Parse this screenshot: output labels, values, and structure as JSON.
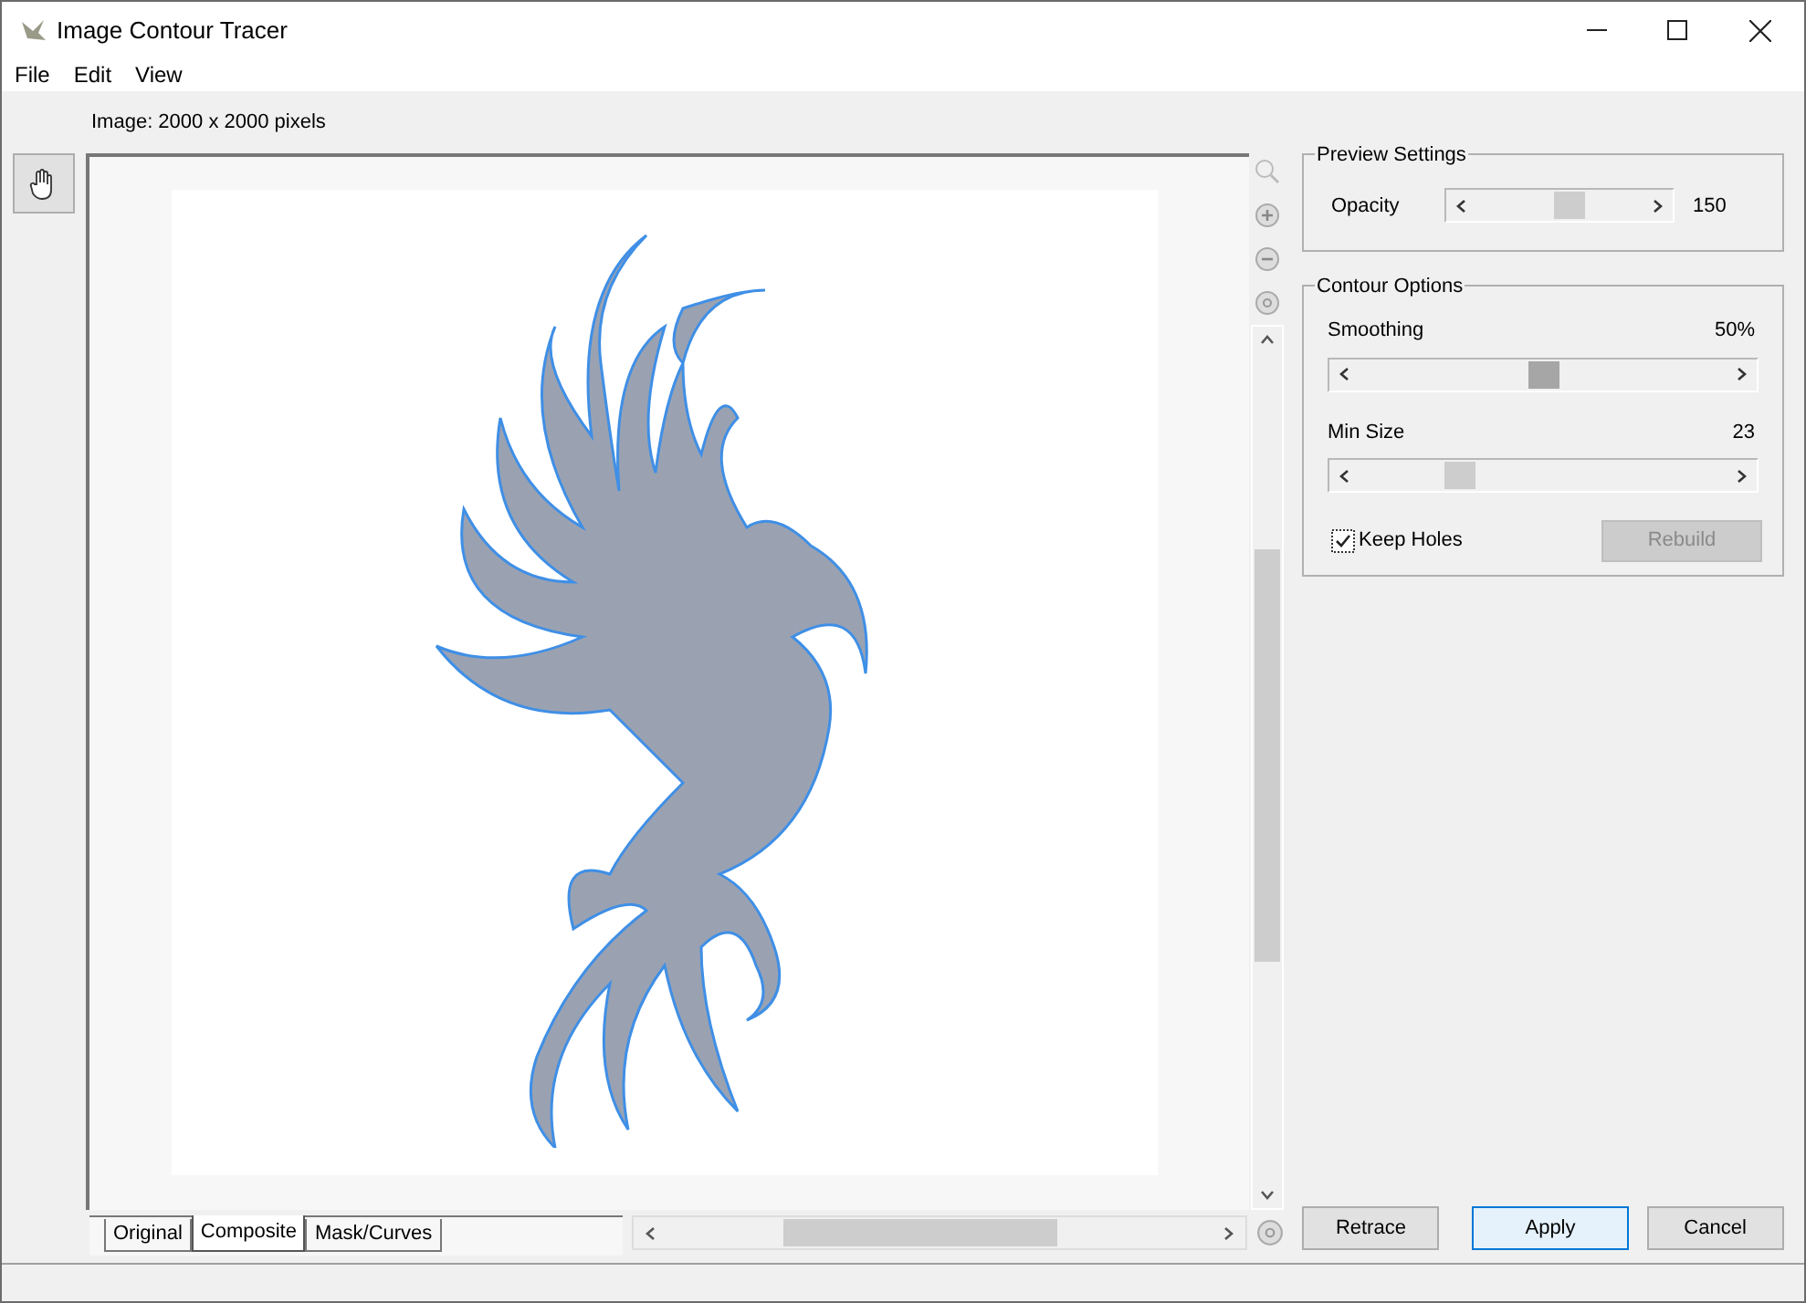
{
  "window": {
    "title": "Image Contour Tracer"
  },
  "menu": [
    "File",
    "Edit",
    "View"
  ],
  "image_info": "Image: 2000 x 2000 pixels",
  "view_tabs": [
    {
      "label": "Original",
      "selected": false
    },
    {
      "label": "Composite",
      "selected": true
    },
    {
      "label": "Mask/Curves",
      "selected": false
    }
  ],
  "preview_settings": {
    "title": "Preview Settings",
    "opacity": {
      "label": "Opacity",
      "level": 0.57,
      "reading": "150"
    }
  },
  "contour_options": {
    "title": "Contour Options",
    "sliders": [
      {
        "label": "Smoothing",
        "level": 0.5,
        "reading": "50%",
        "pressed": true
      },
      {
        "label": "Min Size",
        "level": 0.25,
        "reading": "23",
        "pressed": false
      }
    ],
    "keep_holes": {
      "label": "Keep Holes",
      "checked": true
    },
    "rebuild": {
      "label": "Rebuild",
      "disabled": true
    }
  },
  "buttons": [
    {
      "label": "Retrace",
      "default": false
    },
    {
      "label": "Apply",
      "default": true
    },
    {
      "label": "Cancel",
      "default": false
    }
  ]
}
